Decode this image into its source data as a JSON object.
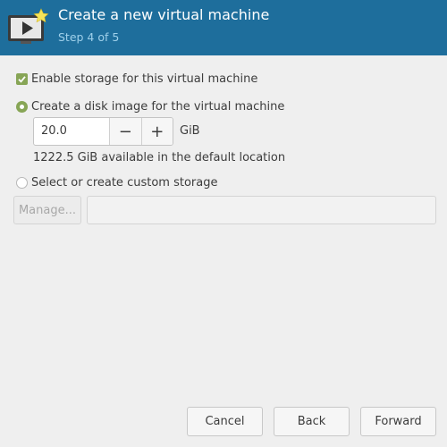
{
  "header": {
    "title": "Create a new virtual machine",
    "step": "Step 4 of 5",
    "icon": "virtual-machine-icon"
  },
  "storage": {
    "enable_label": "Enable storage for this virtual machine",
    "enable_checked": true,
    "create_disk_label": "Create a disk image for the virtual machine",
    "create_disk_selected": true,
    "disk_size": "20.0",
    "decrement": "−",
    "increment": "+",
    "unit": "GiB",
    "available": "1222.5 GiB available in the default location",
    "custom_label": "Select or create custom storage",
    "custom_selected": false,
    "manage_label": "Manage...",
    "custom_path": ""
  },
  "footer": {
    "cancel": "Cancel",
    "back": "Back",
    "forward": "Forward"
  },
  "colors": {
    "header_bg": "#1e6e9c",
    "accent": "#87a556"
  }
}
